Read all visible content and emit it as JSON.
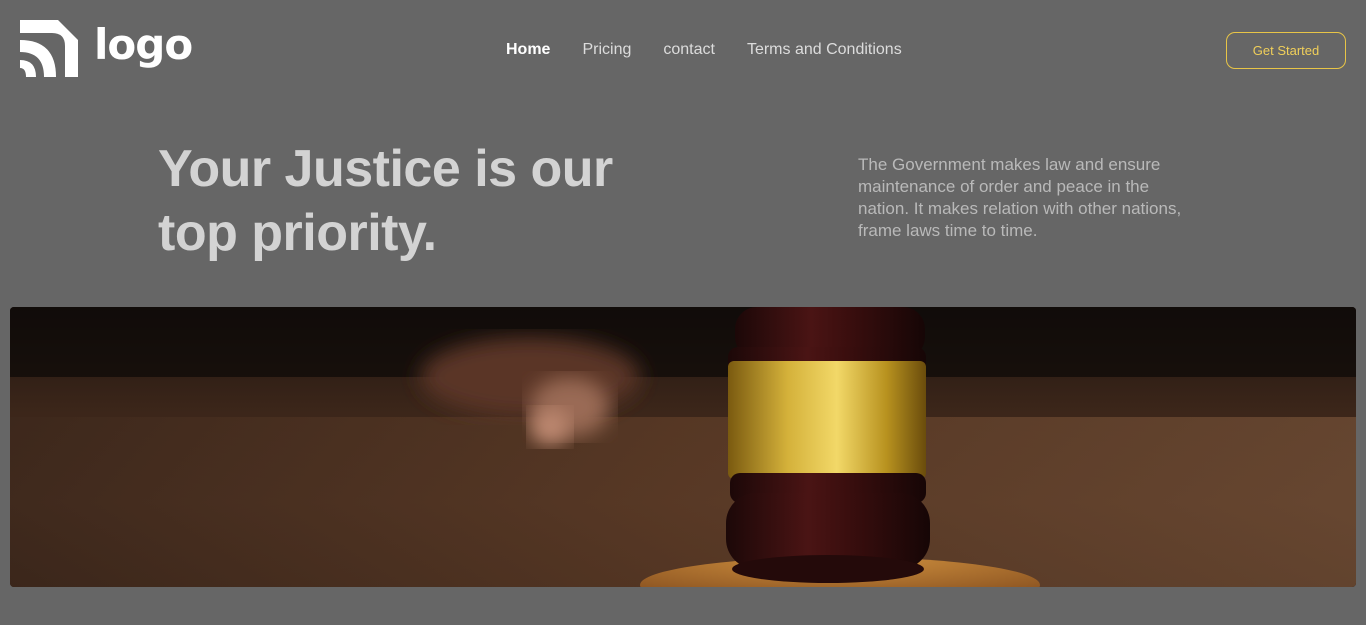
{
  "header": {
    "logo_text": "logo",
    "logo_icon": "signal-arcs-icon",
    "nav": [
      {
        "label": "Home",
        "active": true
      },
      {
        "label": "Pricing",
        "active": false
      },
      {
        "label": "contact",
        "active": false
      },
      {
        "label": "Terms and Conditions",
        "active": false
      }
    ],
    "cta_label": "Get Started"
  },
  "hero": {
    "headline": "Your Justice is our top priority.",
    "description": "The Government makes law and ensure maintenance of order and peace in the nation. It makes relation with other nations, frame laws time to time.",
    "image_subject": "judge-gavel-photo"
  },
  "colors": {
    "background": "#666666",
    "accent": "#e8c547",
    "headline": "#d3d3d3",
    "body_text": "#b9b9b9"
  }
}
